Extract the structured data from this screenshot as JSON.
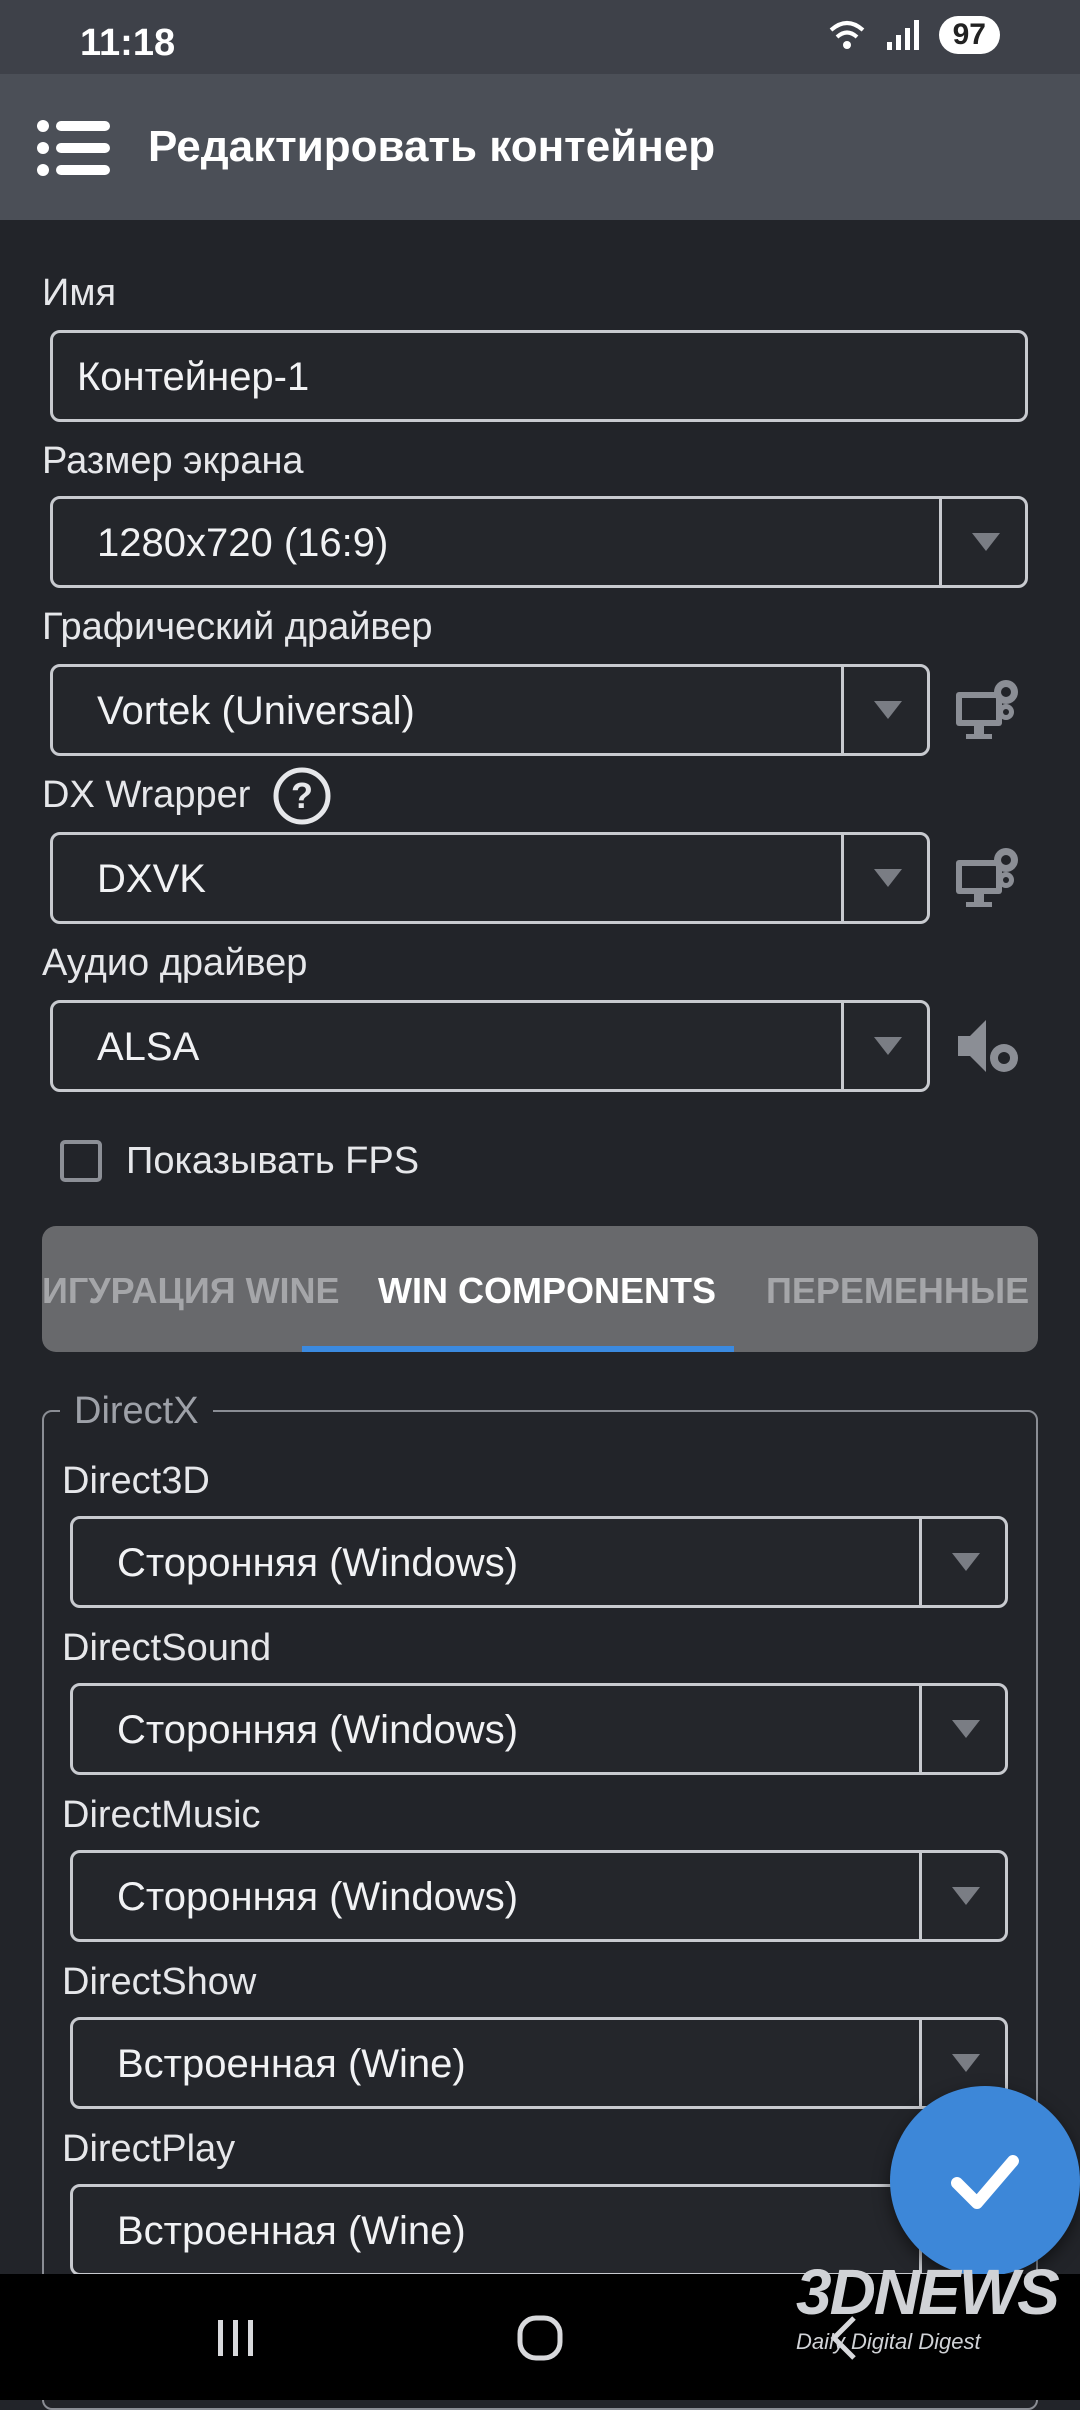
{
  "status_bar": {
    "time": "11:18",
    "battery": "97",
    "icons": [
      "wifi-icon",
      "signal-icon",
      "battery-icon"
    ]
  },
  "toolbar": {
    "title": "Редактировать контейнер",
    "menu_icon": "menu-icon"
  },
  "form": {
    "name_label": "Имя",
    "name_value": "Контейнер-1",
    "screen_label": "Размер экрана",
    "screen_value": "1280x720 (16:9)",
    "gpu_label": "Графический драйвер",
    "gpu_value": "Vortek (Universal)",
    "dx_label": "DX Wrapper",
    "dx_value": "DXVK",
    "audio_label": "Аудио драйвер",
    "audio_value": "ALSA",
    "fps_label": "Показывать FPS",
    "fps_checked": false
  },
  "tabs": {
    "left": "ИГУРАЦИЯ WINE",
    "active": "WIN COMPONENTS",
    "right": "ПЕРЕМЕННЫЕ С"
  },
  "directx": {
    "legend": "DirectX",
    "items": [
      {
        "label": "Direct3D",
        "value": "Сторонняя (Windows)"
      },
      {
        "label": "DirectSound",
        "value": "Сторонняя (Windows)"
      },
      {
        "label": "DirectMusic",
        "value": "Сторонняя (Windows)"
      },
      {
        "label": "DirectShow",
        "value": "Встроенная (Wine)"
      },
      {
        "label": "DirectPlay",
        "value": "Встроенная (Wine)"
      }
    ]
  },
  "watermark": {
    "brand": "3DNEWS",
    "tagline": "Daily Digital Digest"
  },
  "colors": {
    "accent": "#3d87d8",
    "background": "#222429",
    "toolbar": "#4b4f57"
  }
}
